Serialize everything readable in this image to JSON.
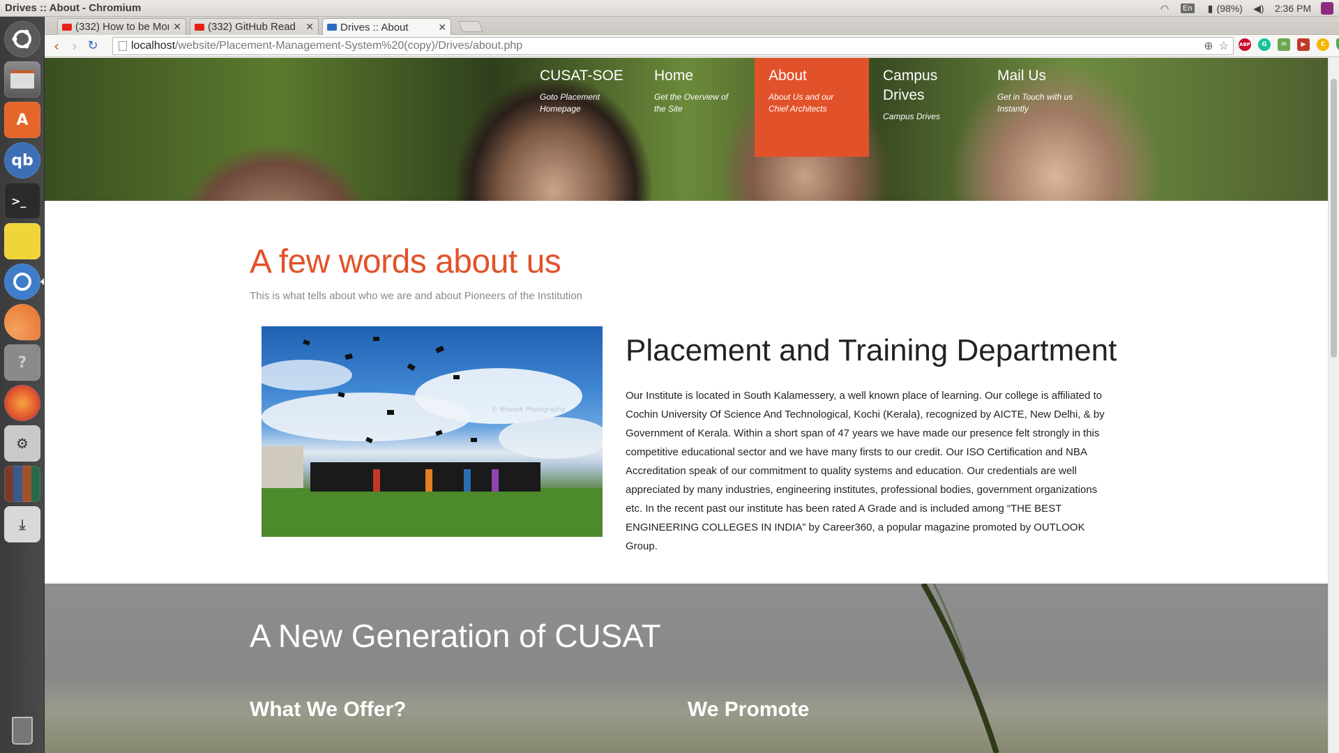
{
  "panel": {
    "window_title": "Drives :: About - Chromium",
    "keyboard_layout": "En",
    "battery": "(98%)",
    "clock": "2:36 PM"
  },
  "launcher": {
    "items": [
      "ubuntu-dash",
      "files",
      "software-center",
      "qbittorrent",
      "terminal",
      "sticky-notes",
      "chromium",
      "orange-app",
      "help",
      "firefox",
      "system-settings",
      "library",
      "installer",
      "trash"
    ]
  },
  "browser": {
    "tabs": [
      {
        "label": "(332) How to be Mor",
        "favicon": "youtube-icon",
        "active": false
      },
      {
        "label": "(332) GitHub Read",
        "favicon": "youtube-icon",
        "active": false
      },
      {
        "label": "Drives :: About",
        "favicon": "page-icon",
        "active": true
      }
    ],
    "url_host": "localhost",
    "url_path": "/website/Placement-Management-System%20(copy)/Drives/about.php",
    "extensions": [
      "ABP",
      "G",
      "✉",
      "▶",
      "C",
      "◆"
    ]
  },
  "nav": [
    {
      "title": "CUSAT-SOE",
      "sub": "Goto Placement Homepage",
      "active": false
    },
    {
      "title": "Home",
      "sub": "Get the Overview of the Site",
      "active": false
    },
    {
      "title": "About",
      "sub": "About Us and our Chief Architects",
      "active": true
    },
    {
      "title": "Campus Drives",
      "sub": "Campus Drives",
      "active": false
    },
    {
      "title": "Mail Us",
      "sub": "Get in Touch with us Instantly",
      "active": false
    }
  ],
  "about": {
    "heading": "A few words about us",
    "subheading": "This is what tells about who we are and about Pioneers of the Institution",
    "photo_watermark": "© Bhavek Photography",
    "dept_heading": "Placement and Training Department",
    "dept_text": "Our Institute is located in South Kalamessery, a well known place of learning. Our college is affiliated to Cochin University Of Science And Technological, Kochi (Kerala), recognized by AICTE, New Delhi, & by Government of Kerala. Within a short span of 47 years we have made our presence felt strongly in this competitive educational sector and we have many firsts to our credit. Our ISO Certification and NBA Accreditation speak of our commitment to quality systems and education. Our credentials are well appreciated by many industries, engineering institutes, professional bodies, government organizations etc. In the recent past our institute has been rated A Grade and is included among “THE BEST ENGINEERING COLLEGES IN INDIA” by Career360, a popular magazine promoted by OUTLOOK Group."
  },
  "generation": {
    "heading": "A New Generation of CUSAT",
    "offer_heading": "What We Offer?",
    "promote_heading": "We Promote"
  },
  "colors": {
    "accent": "#e2522a"
  }
}
